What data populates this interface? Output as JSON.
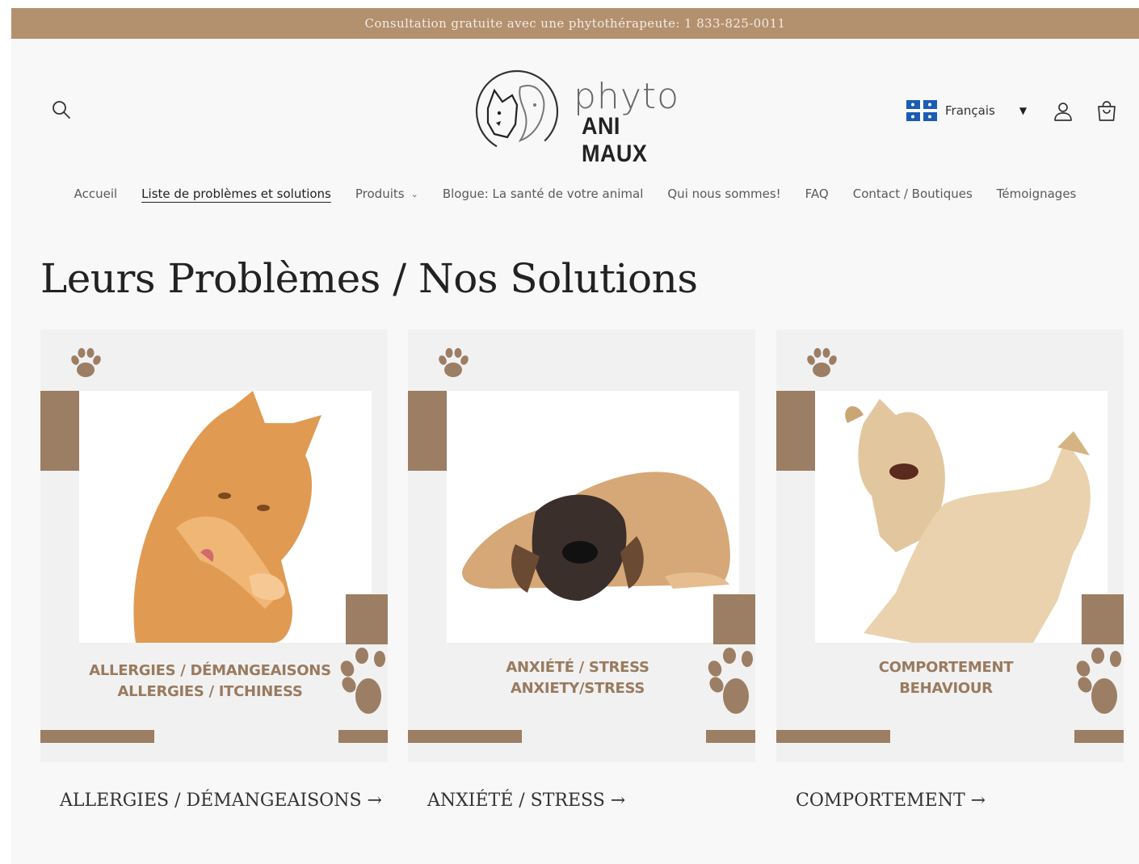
{
  "announcement": "Consultation gratuite avec une phytothérapeute: 1 833-825-0011",
  "logo": {
    "line1": "phyto",
    "line2": "ANI MAUX"
  },
  "header": {
    "search_icon": "search-icon",
    "language": {
      "selected": "Français",
      "flag_icon": "quebec-flag-icon"
    },
    "account_icon": "account-icon",
    "cart_icon": "cart-icon"
  },
  "nav": {
    "items": [
      {
        "label": "Accueil"
      },
      {
        "label": "Liste de problèmes et solutions",
        "active": true
      },
      {
        "label": "Produits",
        "has_dropdown": true
      },
      {
        "label": "Blogue: La santé de votre animal"
      },
      {
        "label": "Qui nous sommes!"
      },
      {
        "label": "FAQ"
      },
      {
        "label": "Contact / Boutiques"
      },
      {
        "label": "Témoignages"
      }
    ]
  },
  "main": {
    "title": "Leurs Problèmes / Nos Solutions",
    "cards": [
      {
        "caption_line1": "ALLERGIES / DÉMANGEAISONS",
        "caption_line2": "ALLERGIES / ITCHINESS",
        "link": "ALLERGIES / DÉMANGEAISONS →",
        "image": "orange-kitten-licking-paw"
      },
      {
        "caption_line1": "ANXIÉTÉ / STRESS",
        "caption_line2": "ANXIETY/STRESS",
        "link": "ANXIÉTÉ / STRESS →",
        "image": "mastiff-puppy-lying-down"
      },
      {
        "caption_line1": "COMPORTEMENT",
        "caption_line2": "BEHAVIOUR",
        "link": "COMPORTEMENT →",
        "image": "two-labrador-puppies-playing"
      }
    ]
  },
  "colors": {
    "brand_brown": "#9c7e64",
    "announcement_bg": "#b3906e",
    "page_bg": "#f8f8f8"
  }
}
